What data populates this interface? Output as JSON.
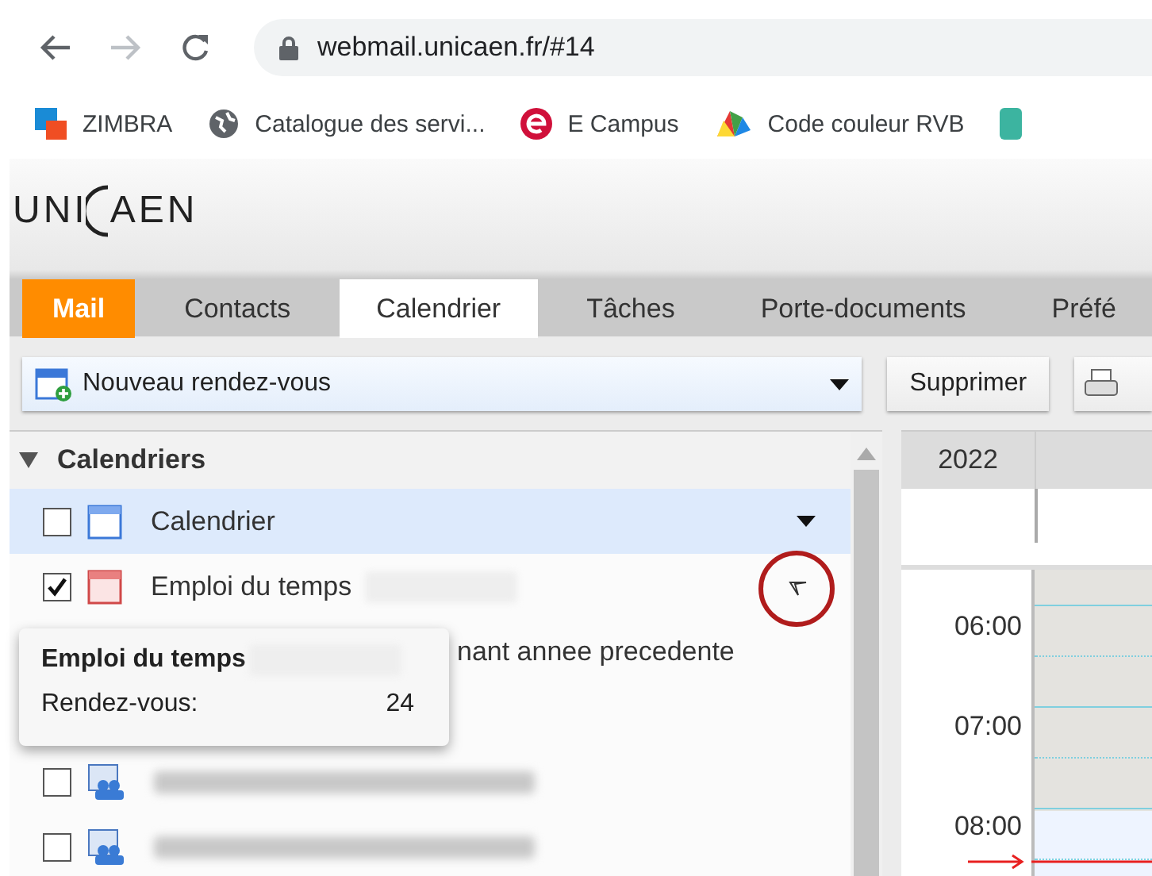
{
  "browser": {
    "url": "webmail.unicaen.fr/#14",
    "bookmarks": [
      {
        "label": "ZIMBRA",
        "kind": "zimbra"
      },
      {
        "label": "Catalogue des servi...",
        "kind": "globe"
      },
      {
        "label": "E Campus",
        "kind": "ecampus"
      },
      {
        "label": "Code couleur RVB",
        "kind": "palette"
      }
    ]
  },
  "logo": {
    "left": "UNI",
    "right": "AEN"
  },
  "tabs": [
    {
      "label": "Mail",
      "selected": false,
      "kind": "accent"
    },
    {
      "label": "Contacts",
      "selected": false,
      "kind": "plain"
    },
    {
      "label": "Calendrier",
      "selected": true,
      "kind": "plain"
    },
    {
      "label": "Tâches",
      "selected": false,
      "kind": "plain"
    },
    {
      "label": "Porte-documents",
      "selected": false,
      "kind": "plain"
    },
    {
      "label": "Préfé",
      "selected": false,
      "kind": "plain"
    }
  ],
  "toolbar": {
    "new_button": "Nouveau rendez-vous",
    "delete_button": "Supprimer"
  },
  "sidebar": {
    "title": "Calendriers",
    "expanded": true,
    "items": [
      {
        "label": "Calendrier",
        "kind": "personal",
        "checked": false,
        "selected": true,
        "blurred": false
      },
      {
        "label": "Emploi du temps",
        "kind": "schedule",
        "checked": true,
        "selected": false,
        "blurred": true
      },
      {
        "label": "nant annee precedente",
        "kind": "covered",
        "selected": false
      },
      {
        "kind": "covered",
        "selected": false
      },
      {
        "kind": "shared",
        "checked": false,
        "selected": false,
        "blurred": true
      },
      {
        "kind": "shared",
        "checked": false,
        "selected": false,
        "blurred": true
      }
    ]
  },
  "tooltip": {
    "title": "Emploi du temps",
    "label": "Rendez-vous:",
    "count": "24"
  },
  "calendar": {
    "year": "2022",
    "hours": [
      "06:00",
      "07:00",
      "08:00"
    ]
  }
}
